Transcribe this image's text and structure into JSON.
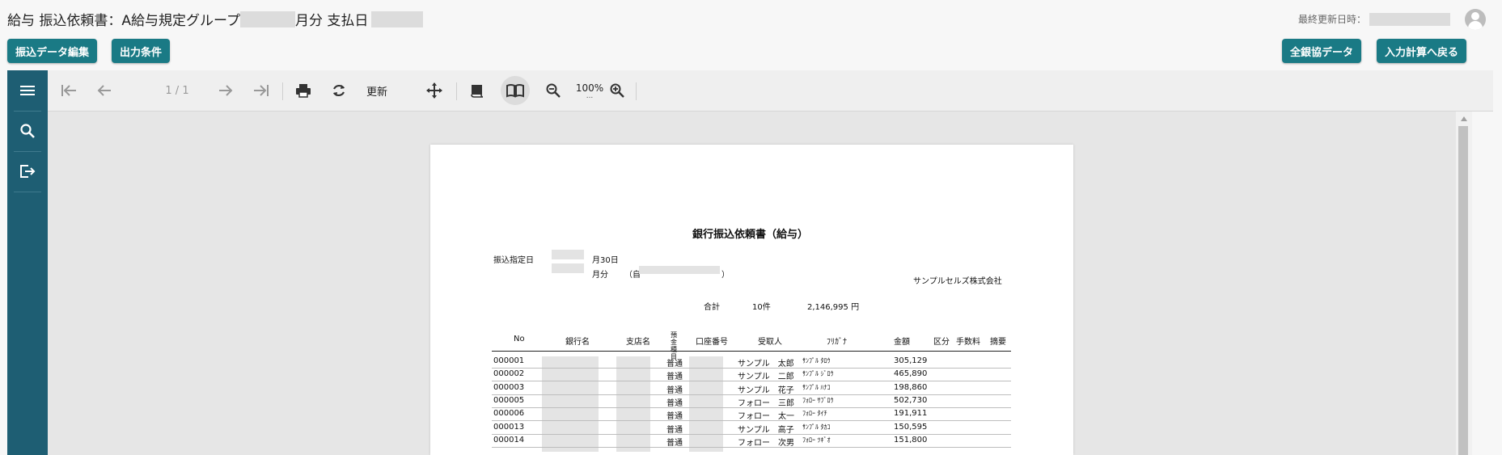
{
  "header": {
    "title_prefix": "給与 振込依頼書：A給与規定グループ",
    "title_month_suffix": "月分 支払日",
    "last_updated_label": "最終更新日時："
  },
  "buttons": {
    "edit_transfer": "振込データ編集",
    "output_conditions": "出力条件",
    "zengin_data": "全銀協データ",
    "back_to_input": "入力計算へ戻る"
  },
  "toolbar": {
    "page_indicator": "1 / 1",
    "refresh_label": "更新",
    "zoom": "100%",
    "zoom_dots": "..."
  },
  "icons": {
    "sidebar": [
      "menu-icon",
      "search-icon",
      "export-icon"
    ],
    "toolbar": [
      "first-page-icon",
      "prev-page-icon",
      "next-page-icon",
      "last-page-icon",
      "print-icon",
      "refresh-icon",
      "move-icon",
      "single-page-icon",
      "book-view-icon",
      "zoom-out-icon",
      "zoom-in-icon"
    ]
  },
  "colors": {
    "button_bg": "#1a7a85",
    "sidebar_bg": "#1e5e73"
  },
  "report": {
    "title": "銀行振込依頼書（給与）",
    "date_label": "振込指定日",
    "date_suffix": "月30日",
    "period_label": "月分",
    "period_from": "（自",
    "period_close": "）",
    "company": "サンプルセルズ株式会社",
    "total_label": "合計",
    "total_count": "10件",
    "total_amount": "2,146,995 円",
    "columns": [
      "No",
      "銀行名",
      "支店名",
      "預金種目",
      "口座番号",
      "受取人",
      "ﾌﾘｶﾞﾅ",
      "金額",
      "区分",
      "手数料",
      "摘要"
    ],
    "rows": [
      {
        "no": "000001",
        "type": "普通",
        "name": "サンプル　太郎",
        "kana": "ｻﾝﾌﾟﾙ ﾀﾛｳ",
        "amount": "305,129"
      },
      {
        "no": "000002",
        "type": "普通",
        "name": "サンプル　二郎",
        "kana": "ｻﾝﾌﾟﾙ ｼﾞﾛｳ",
        "amount": "465,890"
      },
      {
        "no": "000003",
        "type": "普通",
        "name": "サンプル　花子",
        "kana": "ｻﾝﾌﾟﾙ ﾊﾅｺ",
        "amount": "198,860"
      },
      {
        "no": "000005",
        "type": "普通",
        "name": "フォロー　三郎",
        "kana": "ﾌｫﾛｰ ｻﾌﾞﾛｳ",
        "amount": "502,730"
      },
      {
        "no": "000006",
        "type": "普通",
        "name": "フォロー　太一",
        "kana": "ﾌｫﾛｰ ﾀｲﾁ",
        "amount": "191,911"
      },
      {
        "no": "000013",
        "type": "普通",
        "name": "サンプル　高子",
        "kana": "ｻﾝﾌﾟﾙ ﾀｶｺ",
        "amount": "150,595"
      },
      {
        "no": "000014",
        "type": "普通",
        "name": "フォロー　次男",
        "kana": "ﾌｫﾛｰ ﾂｷﾞｵ",
        "amount": "151,800"
      }
    ]
  }
}
